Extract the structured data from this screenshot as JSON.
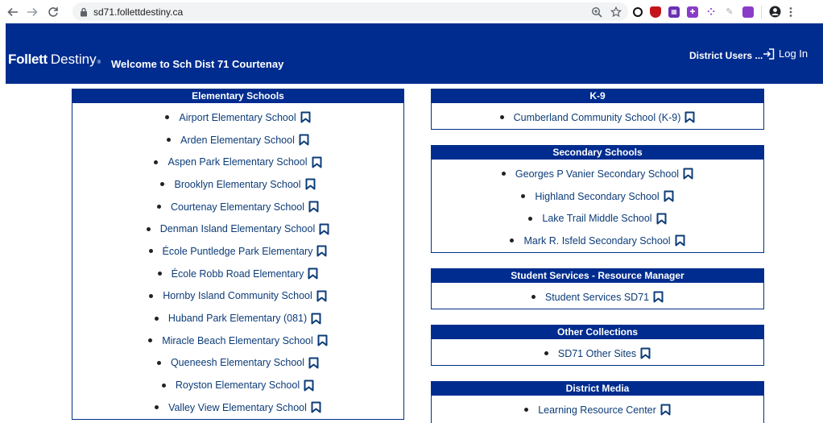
{
  "browser": {
    "url": "sd71.follettdestiny.ca"
  },
  "header": {
    "brand_bold": "Follett",
    "brand_rest": "Destiny",
    "brand_mark": "®",
    "welcome": "Welcome to Sch Dist 71 Courtenay",
    "district_users": "District Users ...",
    "login": "Log In"
  },
  "panels": {
    "elementary": {
      "title": "Elementary Schools",
      "items": [
        "Airport Elementary School",
        "Arden Elementary School",
        "Aspen Park Elementary School",
        "Brooklyn Elementary School",
        "Courtenay Elementary School",
        "Denman Island Elementary School",
        "École Puntledge Park Elementary",
        "École Robb Road Elementary",
        "Hornby Island Community School",
        "Huband Park Elementary (081)",
        "Miracle Beach Elementary School",
        "Queneesh Elementary School",
        "Royston Elementary School",
        "Valley View Elementary School"
      ]
    },
    "k9": {
      "title": "K-9",
      "items": [
        "Cumberland Community School (K-9)"
      ]
    },
    "secondary": {
      "title": "Secondary Schools",
      "items": [
        "Georges P Vanier Secondary School",
        "Highland Secondary School",
        "Lake Trail Middle School",
        "Mark R. Isfeld Secondary School"
      ]
    },
    "student_services": {
      "title": "Student Services - Resource Manager",
      "items": [
        "Student Services SD71"
      ]
    },
    "other": {
      "title": "Other Collections",
      "items": [
        "SD71 Other Sites"
      ]
    },
    "media": {
      "title": "District Media",
      "items": [
        "Learning Resource Center"
      ]
    }
  },
  "colors": {
    "banner": "#002c8f",
    "link": "#0c3c78"
  },
  "icons": {
    "bookmark": "bookmark-icon"
  }
}
